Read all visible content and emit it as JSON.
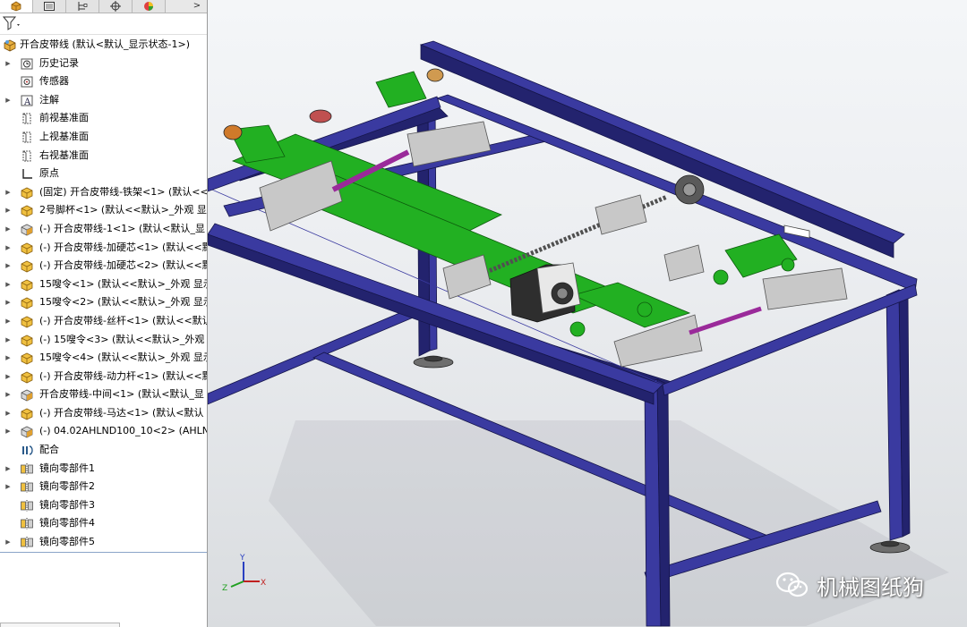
{
  "colors": {
    "frame": "#3a3aa0",
    "frame_dark": "#23236e",
    "belt_green": "#22b022",
    "rail_grey": "#c8c8c8",
    "rod_purple": "#9a2a9a",
    "handwheel": "#5a5a5a"
  },
  "tabs": [
    {
      "icon": "feature-manager-icon",
      "active": true
    },
    {
      "icon": "property-manager-icon"
    },
    {
      "icon": "configuration-manager-icon"
    },
    {
      "icon": "dimxpert-icon"
    },
    {
      "icon": "display-manager-icon"
    }
  ],
  "tab_more": ">",
  "filter_icon": "filter-icon",
  "tree": [
    {
      "text": "开合皮带线  (默认<默认_显示状态-1>)",
      "icon": "assembly-icon",
      "level": 0,
      "expand": false
    },
    {
      "text": "历史记录",
      "icon": "history-icon",
      "level": 1,
      "expand": true
    },
    {
      "text": "传感器",
      "icon": "sensor-icon",
      "level": 1,
      "expand": false
    },
    {
      "text": "注解",
      "icon": "annotation-icon",
      "level": 1,
      "expand": true
    },
    {
      "text": "前视基准面",
      "icon": "plane-icon",
      "level": 1,
      "expand": false
    },
    {
      "text": "上视基准面",
      "icon": "plane-icon",
      "level": 1,
      "expand": false
    },
    {
      "text": "右视基准面",
      "icon": "plane-icon",
      "level": 1,
      "expand": false
    },
    {
      "text": "原点",
      "icon": "origin-icon",
      "level": 1,
      "expand": false
    },
    {
      "text": "(固定) 开合皮带线-铁架<1> (默认<<默",
      "icon": "subassembly-icon",
      "level": 1,
      "expand": true
    },
    {
      "text": "2号脚杯<1> (默认<<默认>_外观 显",
      "icon": "subassembly-icon",
      "level": 1,
      "expand": true
    },
    {
      "text": "(-) 开合皮带线-1<1> (默认<默认_显",
      "icon": "part-icon",
      "level": 1,
      "expand": true
    },
    {
      "text": "(-) 开合皮带线-加硬芯<1> (默认<<默",
      "icon": "subassembly-icon",
      "level": 1,
      "expand": true
    },
    {
      "text": "(-) 开合皮带线-加硬芯<2> (默认<<默",
      "icon": "subassembly-icon",
      "level": 1,
      "expand": true
    },
    {
      "text": "15嗖令<1> (默认<<默认>_外观 显示",
      "icon": "subassembly-icon",
      "level": 1,
      "expand": true
    },
    {
      "text": "15嗖令<2> (默认<<默认>_外观 显示",
      "icon": "subassembly-icon",
      "level": 1,
      "expand": true
    },
    {
      "text": "(-) 开合皮带线-丝杆<1> (默认<<默认",
      "icon": "subassembly-icon",
      "level": 1,
      "expand": true
    },
    {
      "text": "(-) 15嗖令<3> (默认<<默认>_外观",
      "icon": "subassembly-icon",
      "level": 1,
      "expand": true
    },
    {
      "text": "15嗖令<4> (默认<<默认>_外观 显示",
      "icon": "subassembly-icon",
      "level": 1,
      "expand": true
    },
    {
      "text": "(-) 开合皮带线-动力杆<1> (默认<<默",
      "icon": "subassembly-icon",
      "level": 1,
      "expand": true
    },
    {
      "text": "开合皮带线-中间<1> (默认<默认_显",
      "icon": "part-icon",
      "level": 1,
      "expand": true
    },
    {
      "text": "(-) 开合皮带线-马达<1> (默认<默认",
      "icon": "subassembly-icon",
      "level": 1,
      "expand": true
    },
    {
      "text": "(-) 04.02AHLND100_10<2> (AHLN",
      "icon": "part-icon",
      "level": 1,
      "expand": true
    },
    {
      "text": "配合",
      "icon": "mates-icon",
      "level": 1,
      "expand": false
    },
    {
      "text": "镜向零部件1",
      "icon": "mirror-component-icon",
      "level": 1,
      "expand": true
    },
    {
      "text": "镜向零部件2",
      "icon": "mirror-component-icon",
      "level": 1,
      "expand": true
    },
    {
      "text": "镜向零部件3",
      "icon": "mirror-component-icon",
      "level": 1,
      "expand": false
    },
    {
      "text": "镜向零部件4",
      "icon": "mirror-component-icon",
      "level": 1,
      "expand": false
    },
    {
      "text": "镜向零部件5",
      "icon": "mirror-component-icon",
      "level": 1,
      "expand": true
    }
  ],
  "watermark": {
    "text": "机械图纸狗",
    "icon": "wechat-icon"
  },
  "triad": {
    "x": "X",
    "y": "Y",
    "z": "Z"
  }
}
